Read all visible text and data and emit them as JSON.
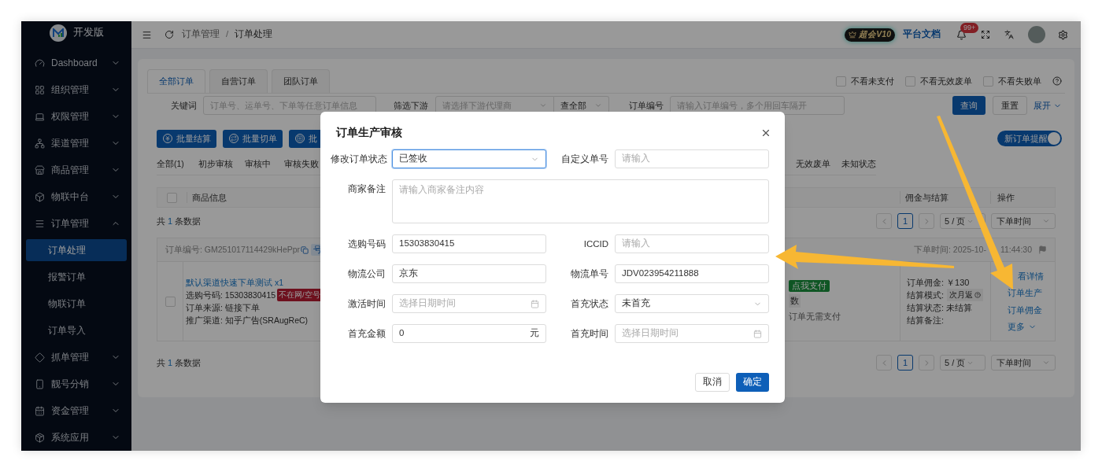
{
  "sidebar": {
    "logo_text": "开发版",
    "items": [
      {
        "label": "Dashboard",
        "expanded": false
      },
      {
        "label": "组织管理",
        "expanded": false
      },
      {
        "label": "权限管理",
        "expanded": false
      },
      {
        "label": "渠道管理",
        "expanded": false
      },
      {
        "label": "商品管理",
        "expanded": false
      },
      {
        "label": "物联中台",
        "expanded": false
      },
      {
        "label": "订单管理",
        "expanded": true,
        "children": [
          {
            "label": "订单处理",
            "selected": true
          },
          {
            "label": "报警订单",
            "selected": false
          },
          {
            "label": "物联订单",
            "selected": false
          },
          {
            "label": "订单导入",
            "selected": false
          }
        ]
      },
      {
        "label": "抓单管理",
        "expanded": false
      },
      {
        "label": "靓号分销",
        "expanded": false
      },
      {
        "label": "资金管理",
        "expanded": false
      },
      {
        "label": "系统应用",
        "expanded": false
      }
    ]
  },
  "header": {
    "breadcrumb": [
      "订单管理",
      "订单处理"
    ],
    "separator": "/",
    "vip_badge": "超会V10",
    "docs_link": "平台文档",
    "notification_count": "99+"
  },
  "order_tabs": [
    {
      "label": "全部订单",
      "selected": true
    },
    {
      "label": "自营订单",
      "selected": false
    },
    {
      "label": "团队订单",
      "selected": false
    }
  ],
  "filter_checkboxes": [
    {
      "label": "不看未支付",
      "checked": false
    },
    {
      "label": "不看无效废单",
      "checked": false
    },
    {
      "label": "不看失败单",
      "checked": false
    }
  ],
  "search": {
    "keyword_label": "关键词",
    "keyword_placeholder": "订单号、运单号、下单等任意订单信息",
    "downstream_label": "筛选下游",
    "downstream_placeholder": "请选择下游代理商",
    "scope": "查全部",
    "order_no_label": "订单编号",
    "order_no_placeholder": "请输入订单编号，多个用回车隔开",
    "query_button": "查询",
    "reset_button": "重置",
    "expand_link": "展开"
  },
  "batch_buttons": [
    "批量结算",
    "批量切单",
    "批"
  ],
  "new_order_alert": {
    "label": "新订单提醒",
    "on": true
  },
  "status_tabs": [
    "全部(1)",
    "初步审核",
    "审核中",
    "审核失败",
    "无效废单",
    "未知状态"
  ],
  "table": {
    "select_all_checked": false,
    "columns": [
      "商品信息",
      "佣金与结算",
      "操作"
    ]
  },
  "summary_top": {
    "prefix": "共",
    "count": "1",
    "suffix": "条数据"
  },
  "pagination_top": {
    "page": "1",
    "page_size": "5 / 页",
    "sort": "下单时间"
  },
  "order": {
    "checked": false,
    "order_no": "订单编号: GM251017114429kHePpr",
    "type_tag": "号",
    "order_time_start": "下单时间: 2025-10-",
    "order_time_end": "11:44:30",
    "product": "默认渠道快速下单测试 x1",
    "number": "选购号码: 15303830415",
    "number_tag": "不在网/空号",
    "source": "订单来源: 链接下单",
    "channel": "推广渠道: 知乎广告(SRAugReC)",
    "pay_tag": "点我支付",
    "count_fragment": "数",
    "pay_note": "订单无需支付",
    "commission": "订单佣金: ￥130",
    "settle_mode_label": "结算模式:",
    "settle_mode": "次月返",
    "settle_status": "结算状态: 未结算",
    "settle_note": "结算备注:",
    "actions": [
      "看详情",
      "订单生产",
      "订单佣金"
    ],
    "more": "更多"
  },
  "summary_bottom": {
    "prefix": "共",
    "count": "1",
    "suffix": "条数据"
  },
  "pagination_bottom": {
    "page": "1",
    "page_size": "5 / 页",
    "sort": "下单时间"
  },
  "modal": {
    "title": "订单生产审核",
    "fields": [
      {
        "label": "修改订单状态",
        "kind": "select",
        "value": "已签收",
        "focused": true
      },
      {
        "label": "自定义单号",
        "kind": "input",
        "placeholder": "请输入",
        "focused": false
      },
      {
        "label": "商家备注",
        "kind": "textarea",
        "placeholder": "请输入商家备注内容",
        "focused": false
      },
      {
        "label": "选购号码",
        "kind": "input",
        "value": "15303830415",
        "focused": false
      },
      {
        "label": "ICCID",
        "kind": "input",
        "placeholder": "请输入",
        "focused": false
      },
      {
        "label": "物流公司",
        "kind": "input",
        "value": "京东",
        "focused": false
      },
      {
        "label": "物流单号",
        "kind": "input",
        "value": "JDV023954211888",
        "focused": false
      },
      {
        "label": "激活时间",
        "kind": "date",
        "placeholder": "选择日期时间",
        "focused": false
      },
      {
        "label": "首充状态",
        "kind": "select",
        "value": "未首充",
        "focused": false
      },
      {
        "label": "首充金额",
        "kind": "input",
        "value": "0",
        "suffix": "元",
        "focused": false
      },
      {
        "label": "首充时间",
        "kind": "date",
        "placeholder": "选择日期时间",
        "focused": false
      }
    ],
    "buttons": [
      {
        "label": "取消",
        "primary": false
      },
      {
        "label": "确定",
        "primary": true
      }
    ]
  }
}
